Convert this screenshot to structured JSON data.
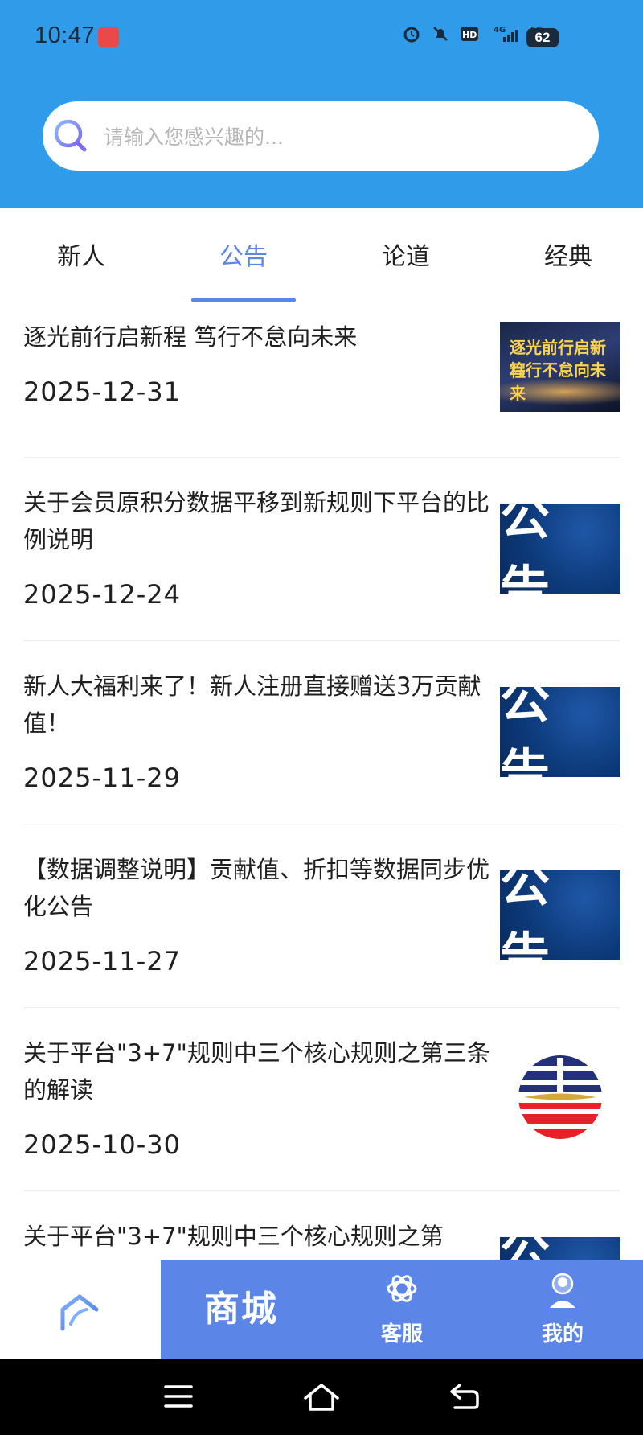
{
  "status_bar": {
    "time": "10:47",
    "battery": "62",
    "network_labels": [
      "HD",
      "4G",
      "5G"
    ]
  },
  "search": {
    "placeholder": "请输入您感兴趣的..."
  },
  "tabs": [
    {
      "label": "新人",
      "active": false
    },
    {
      "label": "公告",
      "active": true
    },
    {
      "label": "论道",
      "active": false
    },
    {
      "label": "经典",
      "active": false
    }
  ],
  "articles": [
    {
      "title": "逐光前行启新程 笃行不怠向未来",
      "date": "2025-12-31",
      "thumb_type": "hero",
      "thumb_text": [
        "逐光前行启新程",
        "笃行不怠向未来"
      ]
    },
    {
      "title": "关于会员原积分数据平移到新规则下平台的比例说明",
      "date": "2025-12-24",
      "thumb_type": "gonggao",
      "thumb_text": "公告"
    },
    {
      "title": "新人大福利来了！新人注册直接赠送3万贡献值！",
      "date": "2025-11-29",
      "thumb_type": "gonggao",
      "thumb_text": "公告"
    },
    {
      "title": "【数据调整说明】贡献值、折扣等数据同步优化公告",
      "date": "2025-11-27",
      "thumb_type": "gonggao",
      "thumb_text": "公告"
    },
    {
      "title": "关于平台\"3+7\"规则中三个核心规则之第三条的解读",
      "date": "2025-10-30",
      "thumb_type": "logo",
      "thumb_text": ""
    },
    {
      "title": "关于平台\"3+7\"规则中三个核心规则之第",
      "date": "",
      "thumb_type": "gonggao",
      "thumb_text": "公告"
    }
  ],
  "bottom_nav": {
    "home_icon": "home-icon",
    "mall_label": "商城",
    "service_label": "客服",
    "mine_label": "我的"
  },
  "colors": {
    "header_blue": "#2f9be9",
    "accent": "#5b86e8",
    "nav_blue": "#5b86e8"
  }
}
